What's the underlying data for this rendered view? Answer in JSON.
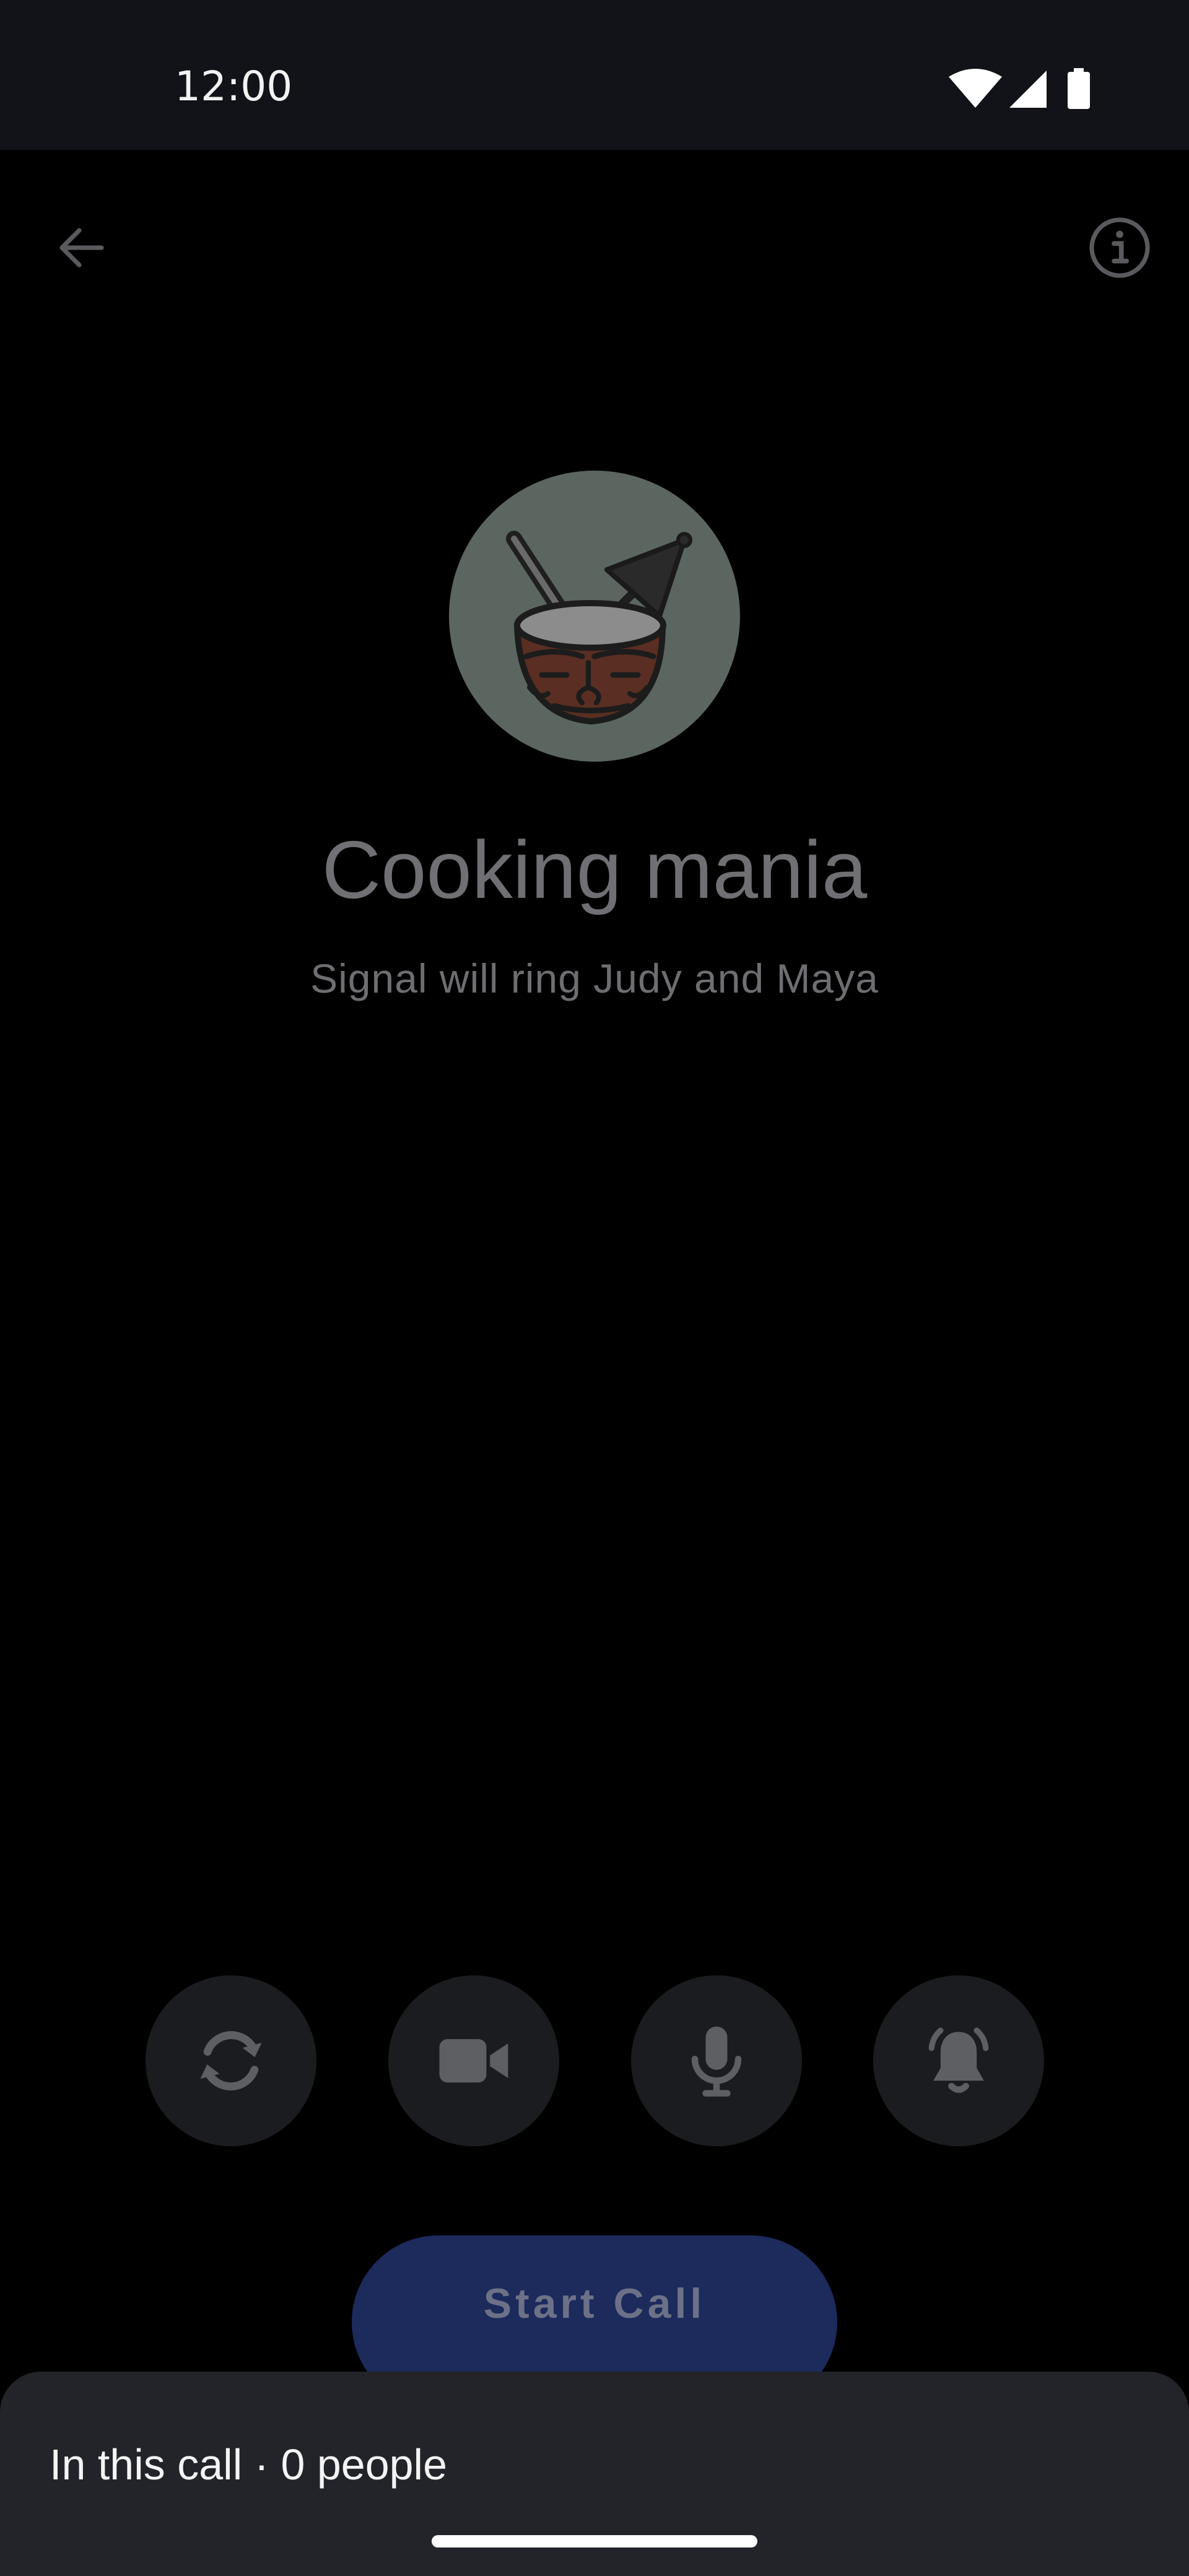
{
  "status_bar": {
    "time": "12:00",
    "icons": [
      "wifi-icon",
      "cell-signal-icon",
      "battery-icon"
    ]
  },
  "app_bar": {
    "back_icon": "arrow-left-icon",
    "info_icon": "info-icon"
  },
  "call": {
    "group_name": "Cooking mania",
    "subtitle": "Signal will ring Judy and Maya",
    "avatar_icon": "coconut-drink-icon"
  },
  "controls": [
    {
      "name": "flip-camera",
      "icon": "camera-flip-icon"
    },
    {
      "name": "video",
      "icon": "video-camera-icon"
    },
    {
      "name": "microphone",
      "icon": "microphone-icon"
    },
    {
      "name": "ring",
      "icon": "bell-ringing-icon"
    }
  ],
  "start_call": {
    "label": "Start Call"
  },
  "bottom_sheet": {
    "title": "In this call · 0 people"
  },
  "colors": {
    "background": "#000000",
    "status_bar": "#121318",
    "start_button": "#1c2a5c",
    "control_button": "#1b1c20",
    "sheet": "#222429"
  }
}
